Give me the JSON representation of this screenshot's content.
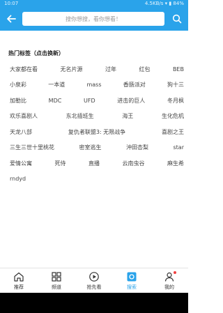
{
  "status_bar": {
    "time": "10:07",
    "right": "4.5KB/s  ▾  ▮ 84%"
  },
  "search": {
    "placeholder": "搜你想搜，看你想看！"
  },
  "section": {
    "title": "热门标签（点击换新）"
  },
  "tags": [
    [
      "大家都在看",
      "无名片源",
      "过年",
      "红包",
      "BEB"
    ],
    [
      "小泉彩",
      "一本道",
      "mass",
      "香肠派对",
      "狗十三"
    ],
    [
      "加勒比",
      "MDC",
      "UFD",
      "进击的巨人",
      "冬月枫"
    ],
    [
      "欢乐喜剧人",
      "东北插班生",
      "海王",
      "生化危机"
    ],
    [
      "天龙八部",
      "复仇者联盟3: 无限战争",
      "喜剧之王"
    ],
    [
      "三生三世十里桃花",
      "密室逃生",
      "沖田杏梨",
      "star"
    ],
    [
      "爱情公寓",
      "死侍",
      "直播",
      "云南虫谷",
      "麻生希"
    ],
    [
      "rndyd"
    ]
  ],
  "nav": [
    {
      "label": "推荐",
      "icon": "home-icon"
    },
    {
      "label": "频道",
      "icon": "grid-icon"
    },
    {
      "label": "抢先看",
      "icon": "play-icon"
    },
    {
      "label": "搜索",
      "icon": "search-tab-icon"
    },
    {
      "label": "我的",
      "icon": "user-icon"
    }
  ],
  "colors": {
    "primary": "#2aa3ea",
    "badge": "#f04040"
  }
}
